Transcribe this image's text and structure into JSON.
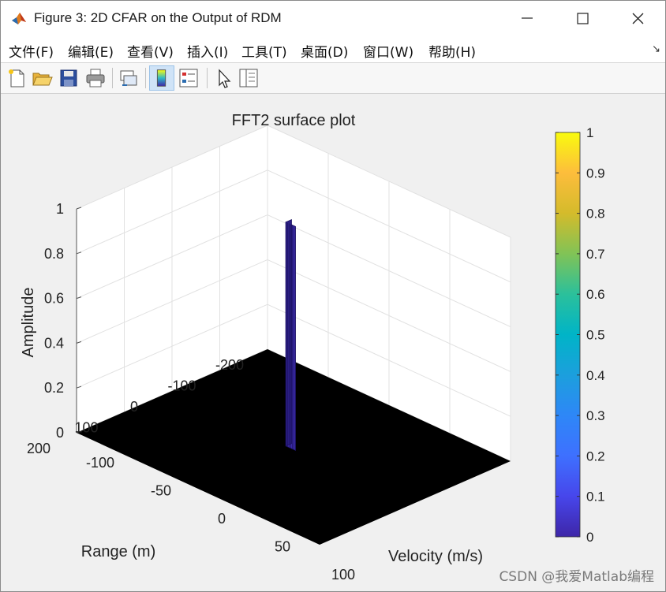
{
  "window": {
    "title": "Figure 3: 2D CFAR on the Output of RDM"
  },
  "menu": [
    "文件(F)",
    "编辑(E)",
    "查看(V)",
    "插入(I)",
    "工具(T)",
    "桌面(D)",
    "窗口(W)",
    "帮助(H)"
  ],
  "toolbar": [
    "new-figure-icon",
    "open-folder-icon",
    "save-icon",
    "print-icon",
    "link-plot-icon",
    "colorbar-icon",
    "legend-icon",
    "pointer-icon",
    "property-inspector-icon"
  ],
  "colors": {
    "surface_floor": "#000000",
    "peak": "#3b2ba6",
    "colormap": "parula"
  },
  "chart_data": {
    "type": "surface",
    "title": "FFT2 surface plot",
    "xlabel": "Velocity (m/s)",
    "ylabel": "Range (m)",
    "zlabel": "Amplitude",
    "x_ticks": [
      "-100",
      "-50",
      "0",
      "50",
      "100"
    ],
    "y_ticks": [
      "200",
      "100",
      "0",
      "-100",
      "-200"
    ],
    "z_ticks": [
      "0",
      "0.2",
      "0.4",
      "0.6",
      "0.8",
      "1"
    ],
    "xlim": [
      -100,
      100
    ],
    "ylim": [
      -200,
      200
    ],
    "zlim": [
      0,
      1
    ],
    "grid": true,
    "peak": {
      "velocity": 0,
      "range": 0,
      "amplitude": 1
    },
    "baseline_amplitude": 0,
    "colorbar": {
      "ticks": [
        "0",
        "0.1",
        "0.2",
        "0.3",
        "0.4",
        "0.5",
        "0.6",
        "0.7",
        "0.8",
        "0.9",
        "1"
      ],
      "range": [
        0,
        1
      ],
      "placement": "right"
    }
  },
  "watermark": "CSDN @我爱Matlab编程"
}
